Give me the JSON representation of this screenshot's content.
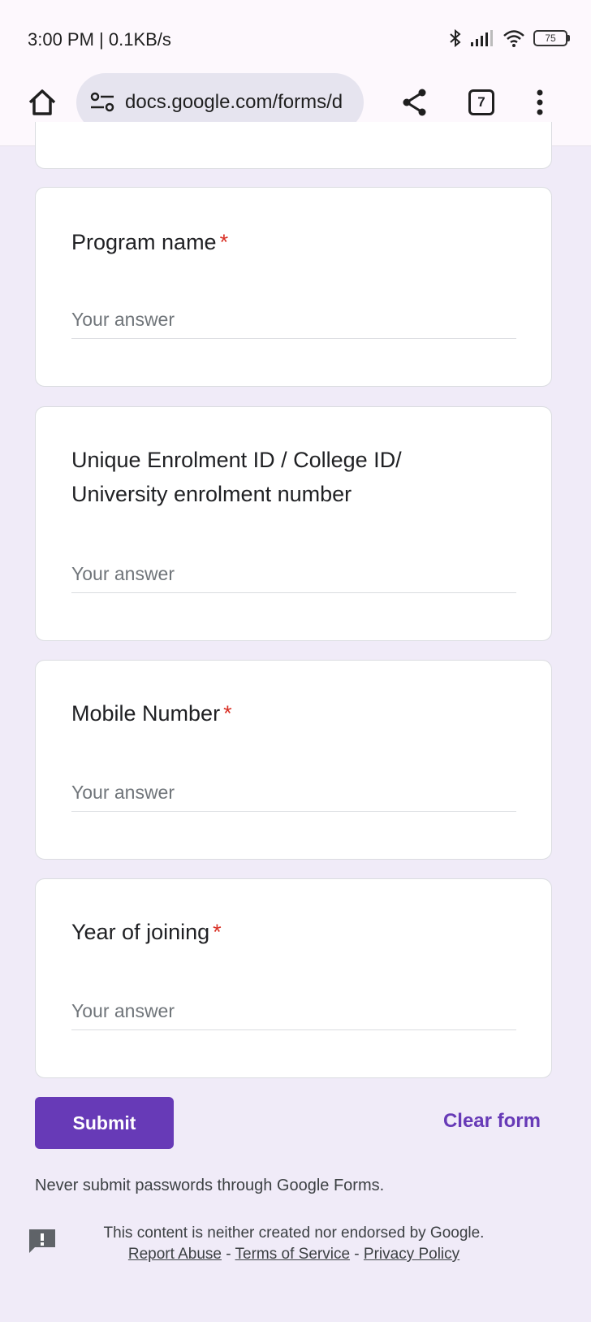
{
  "status_bar": {
    "time": "3:00 PM | 0.1KB/s",
    "battery": "75"
  },
  "browser": {
    "url": "docs.google.com/forms/d",
    "tab_count": "7",
    "icons": [
      "home-icon",
      "site-info-icon",
      "share-icon",
      "tab-switcher-icon",
      "more-vert-icon"
    ]
  },
  "form": {
    "required_mark": "*",
    "questions": [
      {
        "label": "Program name",
        "required": true,
        "placeholder": "Your answer",
        "value": ""
      },
      {
        "label_line1": "Unique Enrolment ID / College ID/",
        "label_line2": "University enrolment number",
        "required": false,
        "placeholder": "Your answer",
        "value": ""
      },
      {
        "label": "Mobile Number",
        "required": true,
        "placeholder": "Your answer",
        "value": ""
      },
      {
        "label": "Year of joining",
        "required": true,
        "placeholder": "Your answer",
        "value": ""
      }
    ],
    "submit_label": "Submit",
    "clear_label": "Clear form",
    "password_note": "Never submit passwords through Google Forms."
  },
  "footer": {
    "disclaimer": "This content is neither created nor endorsed by Google.",
    "report_abuse": "Report Abuse",
    "separator": " - ",
    "terms": "Terms of Service",
    "privacy": "Privacy Policy"
  },
  "colors": {
    "accent": "#673ab7",
    "page_background": "#f0ebf8",
    "required": "#d93025"
  }
}
